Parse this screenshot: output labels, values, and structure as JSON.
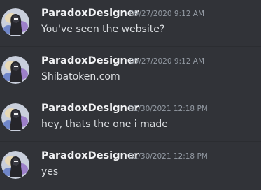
{
  "messages": [
    {
      "author": "ParadoxDesigner",
      "timestamp": "09/27/2020 9:12 AM",
      "content": "You've seen the website?"
    },
    {
      "author": "ParadoxDesigner",
      "timestamp": "09/27/2020 9:12 AM",
      "content": "Shibatoken.com"
    },
    {
      "author": "ParadoxDesigner",
      "timestamp": "01/30/2021 12:18 PM",
      "content": "hey, thats the one i made"
    },
    {
      "author": "ParadoxDesigner",
      "timestamp": "01/30/2021 12:18 PM",
      "content": "yes"
    }
  ],
  "colors": {
    "background": "#313338",
    "author": "#f2f3f5",
    "timestamp": "#949ba4",
    "text": "#dbdee1"
  }
}
